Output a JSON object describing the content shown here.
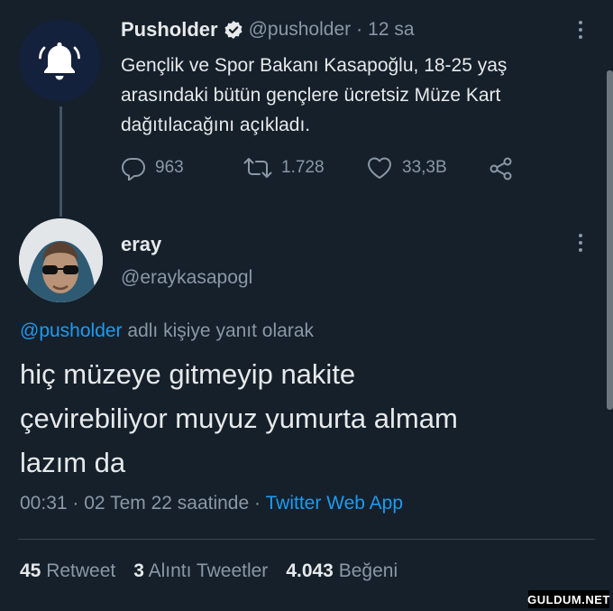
{
  "original_tweet": {
    "display_name": "Pusholder",
    "handle": "@pusholder",
    "separator": "·",
    "time": "12 sa",
    "text_lines": [
      "Gençlik ve Spor Bakanı Kasapoğlu, 18-25 yaş",
      "arasındaki bütün gençlere ücretsiz Müze Kart",
      "dağıtılacağını açıkladı."
    ],
    "replies": "963",
    "retweets": "1.728",
    "likes": "33,3B"
  },
  "reply_tweet": {
    "display_name": "eray",
    "handle": "@eraykasapogl",
    "reply_to_handle": "@pusholder",
    "reply_to_suffix": "adlı kişiye yanıt olarak",
    "text_lines": [
      "hiç müzeye gitmeyip nakite",
      "çevirebiliyor muyuz yumurta almam",
      "lazım da"
    ],
    "time": "00:31",
    "date": "02 Tem 22 saatinde",
    "separator": "·",
    "source": "Twitter Web App"
  },
  "stats": {
    "retweets_count": "45",
    "retweets_label": "Retweet",
    "quotes_count": "3",
    "quotes_label": "Alıntı Tweetler",
    "likes_count": "4.043",
    "likes_label": "Beğeni"
  },
  "watermark": "GULDUM.NET",
  "colors": {
    "background": "#15202b",
    "accent": "#1d9bf0",
    "muted": "#8b98a5",
    "text": "#e7e9ea"
  }
}
